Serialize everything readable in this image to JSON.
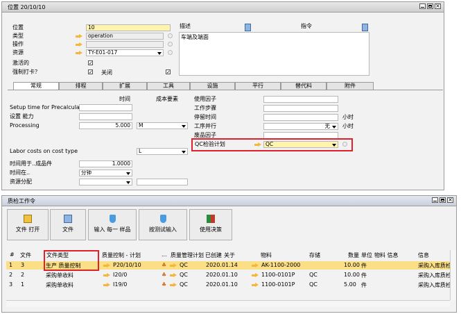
{
  "top_window": {
    "title": "位置 20/10/10",
    "fields": {
      "position_label": "位置",
      "position_value": "10",
      "type_label": "类型",
      "type_value": "operation",
      "operation_label": "操作",
      "operation_value": "",
      "resource_label": "资源",
      "resource_value": "TY-E01-017",
      "active_label": "激活的",
      "force_checkin_label": "强制打卡？",
      "close_label": "关闭",
      "description_label": "描述",
      "instruction_label": "指令",
      "description_text": "车端及端面"
    },
    "tabs": [
      "常规",
      "排程",
      "扩展",
      "工具",
      "设施",
      "平行",
      "替代料",
      "附件"
    ],
    "general": {
      "time_col": "时间",
      "cost_col": "成本要素",
      "setup_label": "Setup time for Precalculati",
      "capacity_label": "设置 能力",
      "processing_label": "Processing",
      "processing_value": "5.000",
      "processing_unit": "M",
      "labor_label": "Labor costs on cost type",
      "labor_value": "L",
      "time_for_label": "时间用于..成品件",
      "time_for_value": "1.0000",
      "time_in_label": "时间在..",
      "time_in_value": "分钟",
      "resource_alloc_label": "资源分配",
      "use_factor_label": "使用因子",
      "work_step_label": "工作步骤",
      "stop_time_label": "停留时间",
      "stop_time_unit": "小时",
      "parallel_label": "工序并行",
      "parallel_value": "无",
      "parallel_unit": "小时",
      "waste_factor_label": "废品因子",
      "qc_plan_label": "QC检验计划",
      "qc_plan_value": "QC"
    }
  },
  "bottom_window": {
    "title": "质检工作令",
    "toolbar": [
      "文件 打开",
      "文件",
      "输入 每一 样品",
      "按测试输入",
      "使用决策"
    ],
    "columns": [
      "#",
      "文件",
      "文件类型",
      "质量控制 - 计划",
      "...",
      "质量管理计划",
      "已创建",
      "关于",
      "物料",
      "存储",
      "数量",
      "单位",
      "物料 信息",
      "信息"
    ],
    "rows": [
      {
        "num": "1",
        "doc": "3",
        "doc_type": "生产 质量控制",
        "plan": "P20/10/10",
        "qm": "QC",
        "created": "2020.01.14",
        "item": "AK-1100-2000",
        "store": "",
        "qty": "10.00",
        "unit": "件",
        "info": "采购入库质检"
      },
      {
        "num": "2",
        "doc": "2",
        "doc_type": "采购单收料",
        "plan": "I20/0",
        "qm": "QC",
        "created": "2020.01.10",
        "item": "1100-0101P",
        "store": "QC",
        "qty": "10.00",
        "unit": "件",
        "info": "采购入库质检"
      },
      {
        "num": "3",
        "doc": "1",
        "doc_type": "采购单收料",
        "plan": "I19/0",
        "qm": "QC",
        "created": "2020.01.10",
        "item": "1100-0101P",
        "store": "QC",
        "qty": "5.00",
        "unit": "件",
        "info": "采购入库质检"
      }
    ]
  }
}
